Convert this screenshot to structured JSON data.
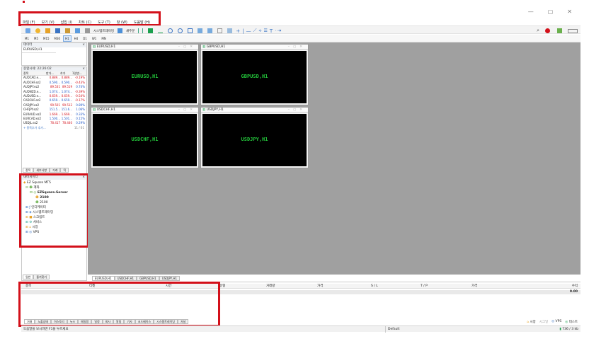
{
  "app": {
    "window_controls": [
      "—",
      "▢",
      "✕"
    ]
  },
  "menu": [
    "파일 (F)",
    "보기 (V)",
    "삽입 (I)",
    "차트 (C)",
    "도구 (T)",
    "창 (W)",
    "도움말 (H)"
  ],
  "toolbar": {
    "algo_label": "시스템트레이딩",
    "new_order_label": "새주문",
    "timeframes": [
      "M1",
      "M5",
      "M15",
      "M30",
      "H1",
      "H4",
      "D1",
      "W1",
      "MN"
    ],
    "active_timeframe": "H1"
  },
  "navigator_top": {
    "title": "데이터",
    "item": "EURUSD,H1"
  },
  "market_watch": {
    "title": "종합시세: 22:26:02",
    "headers": [
      "종목",
      "판가...",
      "호가",
      "1일변..."
    ],
    "rows": [
      [
        "AUDCAD.e...",
        "0.889...",
        "0.889...",
        "-0.19%"
      ],
      [
        "AUDCHF.ez2",
        "0.590...",
        "0.590...",
        "-0.43%"
      ],
      [
        "AUDJPY.ez2",
        "89.531",
        "89.519",
        "0.74%"
      ],
      [
        "AUDNZD.e...",
        "1.074...",
        "1.074...",
        "-0.39%"
      ],
      [
        "AUDUSD.e...",
        "0.659...",
        "0.659...",
        "-0.54%"
      ],
      [
        "CADCHF.ez2",
        "0.659...",
        "0.659...",
        "-0.17%"
      ],
      [
        "CADJPY.ez2",
        "99.501",
        "99.512",
        "0.89%"
      ],
      [
        "CHFJPY.ez2",
        "151.5...",
        "151.6...",
        "1.06%"
      ],
      [
        "EURAUD.ez2",
        "1.669...",
        "1.669...",
        "0.33%"
      ],
      [
        "EURCAD.ez2",
        "1.500...",
        "1.501...",
        "0.15%"
      ],
      [
        "USDJL.ez2",
        "78.417",
        "78.440",
        "0.29%"
      ]
    ],
    "add_label": "+ 종목추가 추가...",
    "count": "11 / 61",
    "tabs": [
      "종목",
      "세부사항",
      "거래",
      "틱"
    ]
  },
  "navigator": {
    "title": "내비게이터",
    "root": "EZ Square MT5",
    "accounts_label": "계좌",
    "server": "EZSquare-Server",
    "accounts": [
      "2100",
      "2100"
    ],
    "items": [
      "인디케이터",
      "시스템트레이딩",
      "스크립트",
      "서비스",
      "시장",
      "VPS"
    ],
    "tabs": [
      "일반",
      "즐겨찾기"
    ]
  },
  "charts": [
    {
      "title": "EURUSD,H1",
      "label": "EURUSD,H1"
    },
    {
      "title": "GBPUSD,H1",
      "label": "GBPUSD,H1"
    },
    {
      "title": "USDCHF,H1",
      "label": "USDCHF,H1"
    },
    {
      "title": "USDJPY,H1",
      "label": "USDJPY,H1"
    }
  ],
  "chart_tabs": [
    "EURUSD,H1",
    "USDCHF,H1",
    "GBPUSD,H1",
    "USDJPY,H1"
  ],
  "toolbox": {
    "headers": [
      "종목",
      "티켓",
      "시간",
      "유형",
      "거래량",
      "가격",
      "S / L",
      "T / P",
      "가격",
      "수익"
    ],
    "profit_value": "0.00",
    "tabs": [
      "거래",
      "노출상태",
      "히스토리",
      "뉴스",
      "메일함",
      "일정",
      "회사",
      "알림",
      "기사",
      "코드베이스",
      "시스템트레이딩",
      "저널"
    ],
    "right_items": [
      "시장",
      "시그널",
      "VPS",
      "테스트"
    ]
  },
  "status": {
    "help": "도움말을 보시려면 F1을 누르세요",
    "profile": "Default",
    "ping": "736 / 3 kb"
  }
}
